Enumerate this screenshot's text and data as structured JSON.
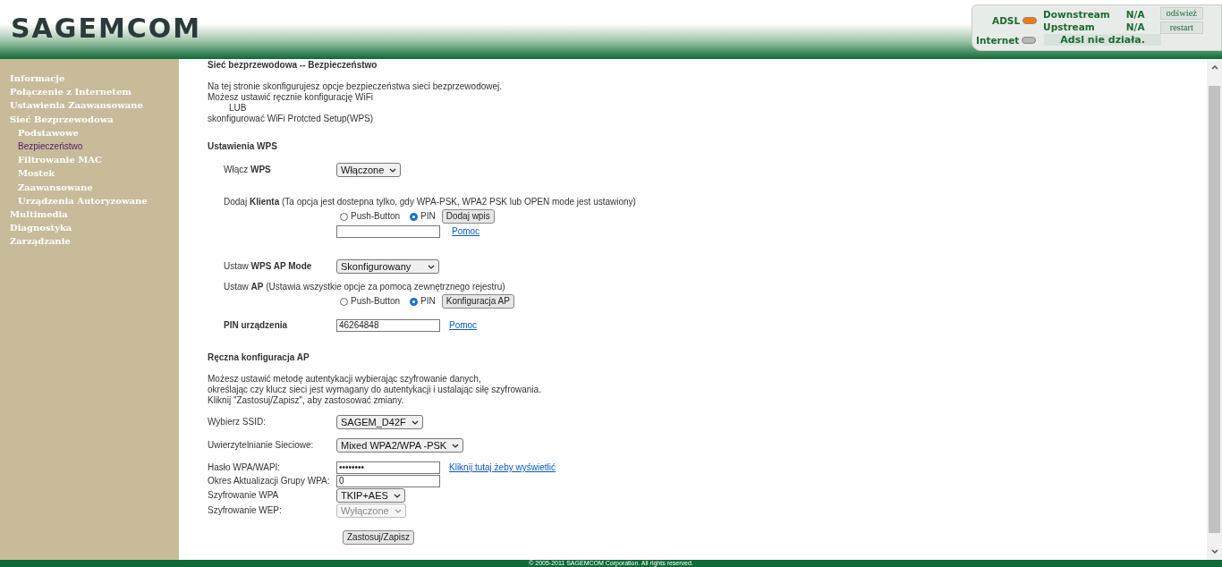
{
  "header": {
    "logo": "SAGEMCOM",
    "status": {
      "adsl": {
        "label": "ADSL",
        "color": "#f07a10"
      },
      "internet": {
        "label": "Internet",
        "color": "#b8b8b8"
      },
      "downstream": {
        "label": "Downstream",
        "value": "N/A"
      },
      "upstream": {
        "label": "Upstream",
        "value": "N/A"
      },
      "message": "Adsl nie działa.",
      "buttons": [
        "odśwież",
        "restart"
      ]
    }
  },
  "sidebar": {
    "items": [
      {
        "label": "Informacje",
        "selected": false
      },
      {
        "label": "Połączenie z Internetem",
        "selected": false
      },
      {
        "label": "Ustawienia Zaawansowane",
        "selected": false
      },
      {
        "label": "Sieć Bezprzewodowa",
        "selected": false,
        "children": [
          {
            "label": "Podstawowe",
            "selected": false
          },
          {
            "label": "Bezpieczeństwo",
            "selected": true
          },
          {
            "label": "Filtrowanie MAC",
            "selected": false
          },
          {
            "label": "Mostek",
            "selected": false
          },
          {
            "label": "Zaawansowane",
            "selected": false
          },
          {
            "label": "Urządzenia Autoryzowane",
            "selected": false
          }
        ]
      },
      {
        "label": "Multimedia",
        "selected": false
      },
      {
        "label": "Diagnostyka",
        "selected": false
      },
      {
        "label": "Zarządzanie",
        "selected": false
      }
    ]
  },
  "content": {
    "title": "Sieć bezprzewodowa -- Bezpieczeństwo",
    "intro": [
      "Na tej stronie skonfigurujesz opcje bezpieczeństwa sieci bezprzewodowej.",
      "Możesz ustawić ręcznie konfigurację WiFi",
      "LUB",
      "skonfigurować WiFi Protcted Setup(WPS)"
    ],
    "wps": {
      "heading": "Ustawienia WPS",
      "enable": {
        "label": "Włącz **WPS**",
        "value": "Włączone"
      },
      "add_client": {
        "label": "Dodaj **Klienta** (Ta opcja jest dostepna tylko, gdy WPA-PSK, WPA2 PSK lub OPEN mode jest ustawiony)",
        "options": [
          {
            "label": "Push-Button",
            "selected": false
          },
          {
            "label": "PIN",
            "selected": true
          }
        ],
        "button": "Dodaj wpis",
        "help": "Pomoc"
      },
      "ap_mode": {
        "label": "Ustaw **WPS AP Mode**",
        "value": "Skonfigurowany"
      },
      "set_ap": {
        "label": "Ustaw **AP** (Ustawia wszystkie opcje za pomocą zewnętrznego rejestru)",
        "options": [
          {
            "label": "Push-Button",
            "selected": false
          },
          {
            "label": "PIN",
            "selected": true
          }
        ],
        "button": "Konfiguracja AP"
      },
      "device_pin": {
        "label": "PIN urządzenia",
        "value": "46264848",
        "help": "Pomoc"
      }
    },
    "manual": {
      "heading": "Ręczna konfiguracja AP",
      "intro": [
        "Możesz ustawić metodę autentykacji wybierając szyfrowanie danych,",
        "określając czy klucz sieci jest wymagany do autentykacji i ustalając siłę szyfrowania.",
        "Kliknij \"Zastosuj/Zapisz\", aby zastosować zmiany."
      ],
      "fields": [
        {
          "kind": "select",
          "label": "Wybierz SSID:",
          "value": "SAGEM_D42F",
          "disabled": false
        },
        {
          "kind": "select",
          "label": "Uwierzytelnianie Sieciowe:",
          "value": "Mixed WPA2/WPA -PSK",
          "disabled": false
        },
        {
          "kind": "password",
          "label": "Hasło WPA/WAPI:",
          "value": "••••••••",
          "link": "Kliknij tutaj żeby wyświetlić"
        },
        {
          "kind": "text",
          "label": "Okres Aktualizacji Grupy WPA:",
          "value": "0"
        },
        {
          "kind": "select",
          "label": "Szyfrowanie WPA",
          "value": "TKIP+AES",
          "disabled": false
        },
        {
          "kind": "select",
          "label": "Szyfrowanie WEP:",
          "value": "Wyłączone",
          "disabled": true
        }
      ],
      "apply_button": "Zastosuj/Zapisz"
    }
  },
  "footer": "© 2005-2011 SAGEMCOM Corporation. All rights reserved."
}
